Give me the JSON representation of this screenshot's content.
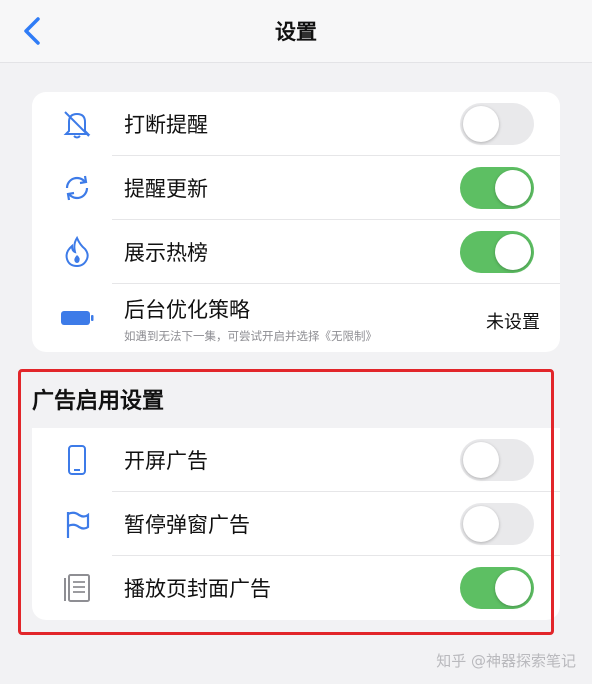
{
  "navbar": {
    "title": "设置",
    "back_icon": "chevron-left-icon"
  },
  "general": {
    "items": [
      {
        "label": "打断提醒",
        "icon": "bell-slash-icon",
        "toggle_on": false
      },
      {
        "label": "提醒更新",
        "icon": "refresh-icon",
        "toggle_on": true
      },
      {
        "label": "展示热榜",
        "icon": "flame-icon",
        "toggle_on": true
      },
      {
        "label": "后台优化策略",
        "icon": "battery-icon",
        "sublabel": "如遇到无法下一集，可尝试开启并选择《无限制》",
        "value": "未设置"
      }
    ]
  },
  "ads": {
    "header": "广告启用设置",
    "items": [
      {
        "label": "开屏广告",
        "icon": "phone-icon",
        "toggle_on": false
      },
      {
        "label": "暂停弹窗广告",
        "icon": "flag-icon",
        "toggle_on": false
      },
      {
        "label": "播放页封面广告",
        "icon": "document-icon",
        "toggle_on": true
      }
    ]
  },
  "watermark": "知乎 @神器探索笔记",
  "colors": {
    "accent": "#2f7cf6",
    "toggle_on": "#5dbf63",
    "highlight_border": "#e2262a"
  }
}
